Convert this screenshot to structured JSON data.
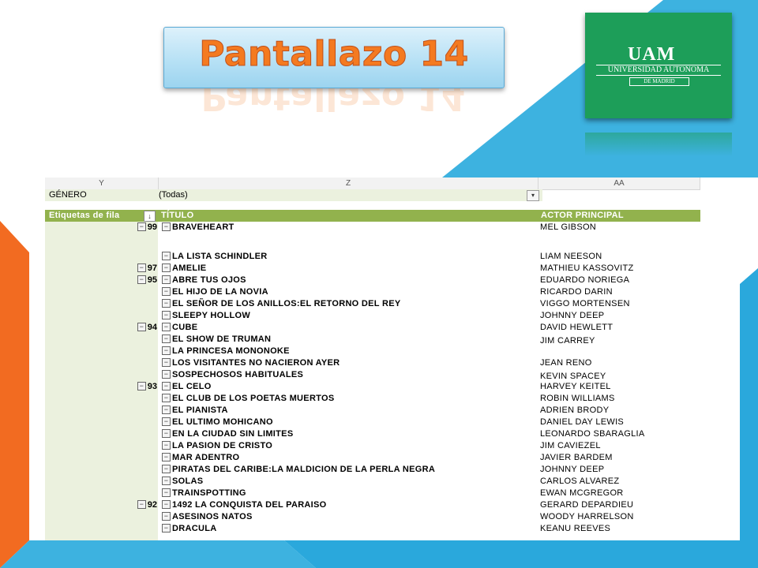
{
  "slide": {
    "title": "Pantallazo 14",
    "colors": {
      "title": "#f47a20",
      "accent_blue": "#3db2e0",
      "accent_orange": "#f26b21",
      "logo_green": "#1d9e59",
      "pivot_header": "#92b24d",
      "pivot_label_bg": "#ebf1de"
    }
  },
  "logo": {
    "mark": "UAM",
    "line1": "UNIVERSIDAD AUTONOMA",
    "line2": "DE MADRID"
  },
  "sheet": {
    "columns": [
      "Y",
      "Z",
      "AA"
    ],
    "filter": {
      "label": "GÉNERO",
      "value": "(Todas)",
      "icon": "dropdown-arrow-icon"
    },
    "headers": {
      "row_labels": "Etiquetas de fila",
      "title": "TÍTULO",
      "actor": "ACTOR PRINCIPAL"
    },
    "rows": [
      {
        "score": "99",
        "title": "BRAVEHEART",
        "actor": "MEL GIBSON"
      },
      {
        "score": "",
        "title": "LA LISTA SCHINDLER",
        "actor": "LIAM NEESON"
      },
      {
        "score": "97",
        "title": "AMELIE",
        "actor": "MATHIEU KASSOVITZ"
      },
      {
        "score": "95",
        "title": "ABRE TUS OJOS",
        "actor": "EDUARDO NORIEGA"
      },
      {
        "score": "",
        "title": "EL HIJO DE LA NOVIA",
        "actor": "RICARDO DARIN"
      },
      {
        "score": "",
        "title": "EL SEÑOR DE LOS ANILLOS:EL RETORNO DEL REY",
        "actor": "VIGGO MORTENSEN"
      },
      {
        "score": "",
        "title": "SLEEPY HOLLOW",
        "actor": "JOHNNY DEEP"
      },
      {
        "score": "94",
        "title": "CUBE",
        "actor": "DAVID HEWLETT"
      },
      {
        "score": "",
        "title": "EL SHOW DE TRUMAN",
        "actor": "JIM CARREY"
      },
      {
        "score": "",
        "title": "LA PRINCESA MONONOKE",
        "actor": ""
      },
      {
        "score": "",
        "title": "LOS VISITANTES NO NACIERON AYER",
        "actor": "JEAN RENO"
      },
      {
        "score": "",
        "title": "SOSPECHOSOS HABITUALES",
        "actor": "KEVIN SPACEY"
      },
      {
        "score": "93",
        "title": "EL CELO",
        "actor": "HARVEY KEITEL"
      },
      {
        "score": "",
        "title": "EL CLUB DE LOS POETAS MUERTOS",
        "actor": "ROBIN WILLIAMS"
      },
      {
        "score": "",
        "title": "EL PIANISTA",
        "actor": "ADRIEN BRODY"
      },
      {
        "score": "",
        "title": "EL ULTIMO MOHICANO",
        "actor": "DANIEL DAY LEWIS"
      },
      {
        "score": "",
        "title": "EN LA CIUDAD SIN LIMITES",
        "actor": "LEONARDO SBARAGLIA"
      },
      {
        "score": "",
        "title": "LA PASION DE CRISTO",
        "actor": "JIM CAVIEZEL"
      },
      {
        "score": "",
        "title": "MAR ADENTRO",
        "actor": "JAVIER BARDEM"
      },
      {
        "score": "",
        "title": "PIRATAS DEL CARIBE:LA MALDICION DE LA PERLA NEGRA",
        "actor": "JOHNNY DEEP"
      },
      {
        "score": "",
        "title": "SOLAS",
        "actor": "CARLOS ALVAREZ"
      },
      {
        "score": "",
        "title": "TRAINSPOTTING",
        "actor": "EWAN MCGREGOR"
      },
      {
        "score": "92",
        "title": "1492 LA CONQUISTA DEL PARAISO",
        "actor": "GERARD DEPARDIEU"
      },
      {
        "score": "",
        "title": "ASESINOS NATOS",
        "actor": "WOODY HARRELSON"
      },
      {
        "score": "",
        "title": "DRACULA",
        "actor": "KEANU REEVES"
      }
    ]
  }
}
